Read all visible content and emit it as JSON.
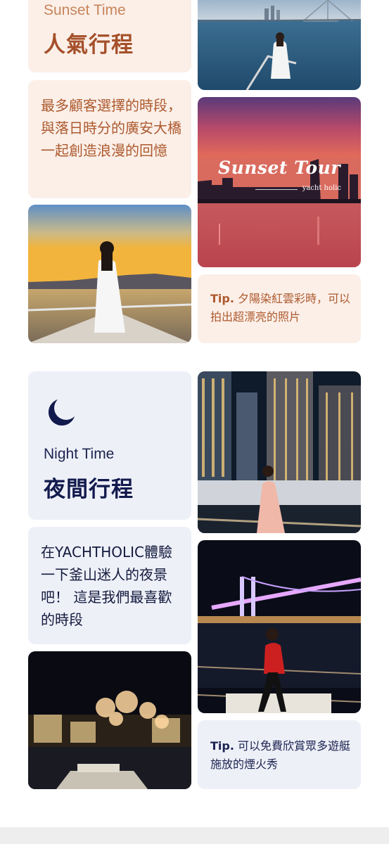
{
  "sunset": {
    "title_en": "Sunset Time",
    "title_cn": "人氣行程",
    "description": "最多顧客選擇的時段，與落日時分的廣安大橋一起創造浪漫的回憶",
    "tip_label": "Tip.",
    "tip_text": " 夕陽染紅雲彩時，可以拍出超漂亮的照片",
    "tour_title": "Sunset Tour",
    "tour_brand": "yacht holic"
  },
  "night": {
    "title_en": "Night Time",
    "title_cn": "夜間行程",
    "description": "在YACHTHOLIC體驗一下釜山迷人的夜景吧！ 這是我們最喜歡的時段",
    "tip_label": "Tip.",
    "tip_text": " 可以免費欣賞眾多遊艇施放的煙火秀"
  },
  "icons": {
    "night": "crescent-moon-icon"
  },
  "colors": {
    "sunset_card_bg": "#fbefe8",
    "sunset_text": "#ad5a2e",
    "night_card_bg": "#eef0f8",
    "night_text": "#121a4d"
  }
}
